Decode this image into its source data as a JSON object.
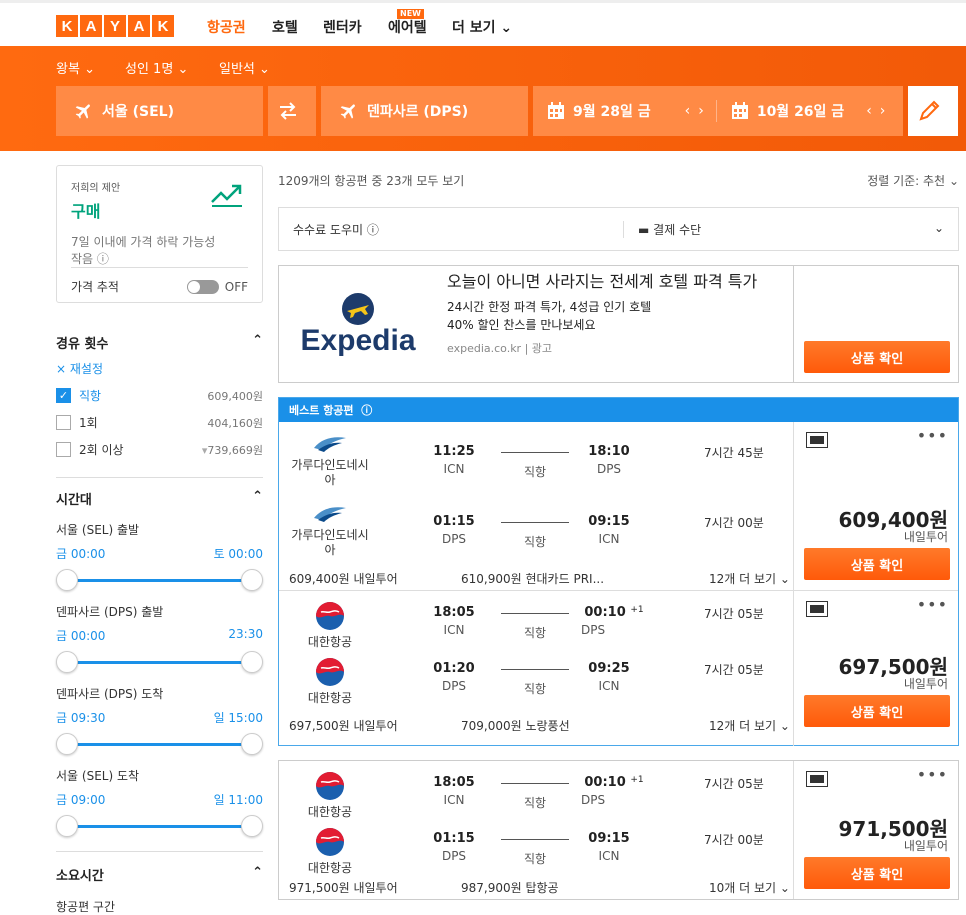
{
  "logo": [
    "K",
    "A",
    "Y",
    "A",
    "K"
  ],
  "nav": {
    "flights": "항공권",
    "hotels": "호텔",
    "cars": "렌터카",
    "airtel": "에어텔",
    "airtel_badge": "NEW",
    "more": "더 보기"
  },
  "search": {
    "trip": "왕복",
    "pax": "성인 1명",
    "cabin": "일반석",
    "origin": "서울 (SEL)",
    "dest": "덴파사르 (DPS)",
    "depart": "9월 28일 금",
    "return": "10월 26일 금"
  },
  "offer": {
    "small": "저희의 제안",
    "big": "구매",
    "desc": "7일 이내에 가격 하락 가능성 작음",
    "track_label": "가격 추적",
    "toggle": "OFF"
  },
  "stops": {
    "title": "경유 횟수",
    "reset": "× 재설정",
    "items": [
      {
        "label": "직항",
        "price": "609,400원",
        "checked": true
      },
      {
        "label": "1회",
        "price": "404,160원",
        "checked": false
      },
      {
        "label": "2회 이상",
        "price": "739,669원",
        "checked": false
      }
    ]
  },
  "times": {
    "title": "시간대",
    "groups": [
      {
        "label": "서울 (SEL) 출발",
        "from": "금 00:00",
        "to": "토 00:00"
      },
      {
        "label": "덴파사르 (DPS) 출발",
        "from": "금 00:00",
        "to": "23:30"
      },
      {
        "label": "덴파사르 (DPS) 도착",
        "from": "금 09:30",
        "to": "일 15:00"
      },
      {
        "label": "서울 (SEL) 도착",
        "from": "금 09:00",
        "to": "일 11:00"
      }
    ]
  },
  "duration": {
    "title": "소요시간",
    "sub": "항공편 구간"
  },
  "results_head": {
    "count": "1209개의 항공편 중 23개 모두 보기",
    "sort": "정렬 기준: 추천"
  },
  "fee": {
    "helper": "수수료 도우미",
    "payment": "결제 수단"
  },
  "ad": {
    "brand": "Expedia",
    "title": "오늘이 아니면 사라지는 전세계 호텔 파격 특가",
    "line1": "24시간 한정 파격 특가, 4성급 인기 호텔",
    "line2": "40% 할인 찬스를 만나보세요",
    "url": "expedia.co.kr | 광고",
    "button": "상품 확인"
  },
  "best_label": "베스트 항공편",
  "results": [
    {
      "legs": [
        {
          "airline": "가루다인도네시아",
          "dep": "11:25",
          "depc": "ICN",
          "stop": "직항",
          "arr": "18:10",
          "plus": "",
          "arrc": "DPS",
          "dur": "7시간 45분"
        },
        {
          "airline": "가루다인도네시아",
          "dep": "01:15",
          "depc": "DPS",
          "stop": "직항",
          "arr": "09:15",
          "plus": "",
          "arrc": "ICN",
          "dur": "7시간 00분"
        }
      ],
      "f1": "609,400원 내일투어",
      "f2": "610,900원 현대카드 PRI...",
      "f3": "12개 더 보기",
      "price": "609,400원",
      "provider": "내일투어",
      "button": "상품 확인"
    },
    {
      "legs": [
        {
          "airline": "대한항공",
          "dep": "18:05",
          "depc": "ICN",
          "stop": "직항",
          "arr": "00:10",
          "plus": "+1",
          "arrc": "DPS",
          "dur": "7시간 05분"
        },
        {
          "airline": "대한항공",
          "dep": "01:20",
          "depc": "DPS",
          "stop": "직항",
          "arr": "09:25",
          "plus": "",
          "arrc": "ICN",
          "dur": "7시간 05분"
        }
      ],
      "f1": "697,500원 내일투어",
      "f2": "709,000원 노랑풍선",
      "f3": "12개 더 보기",
      "price": "697,500원",
      "provider": "내일투어",
      "button": "상품 확인"
    },
    {
      "legs": [
        {
          "airline": "대한항공",
          "dep": "18:05",
          "depc": "ICN",
          "stop": "직항",
          "arr": "00:10",
          "plus": "+1",
          "arrc": "DPS",
          "dur": "7시간 05분"
        },
        {
          "airline": "대한항공",
          "dep": "01:15",
          "depc": "DPS",
          "stop": "직항",
          "arr": "09:15",
          "plus": "",
          "arrc": "ICN",
          "dur": "7시간 00분"
        }
      ],
      "f1": "971,500원 내일투어",
      "f2": "987,900원 탑항공",
      "f3": "10개 더 보기",
      "price": "971,500원",
      "provider": "내일투어",
      "button": "상품 확인"
    }
  ]
}
